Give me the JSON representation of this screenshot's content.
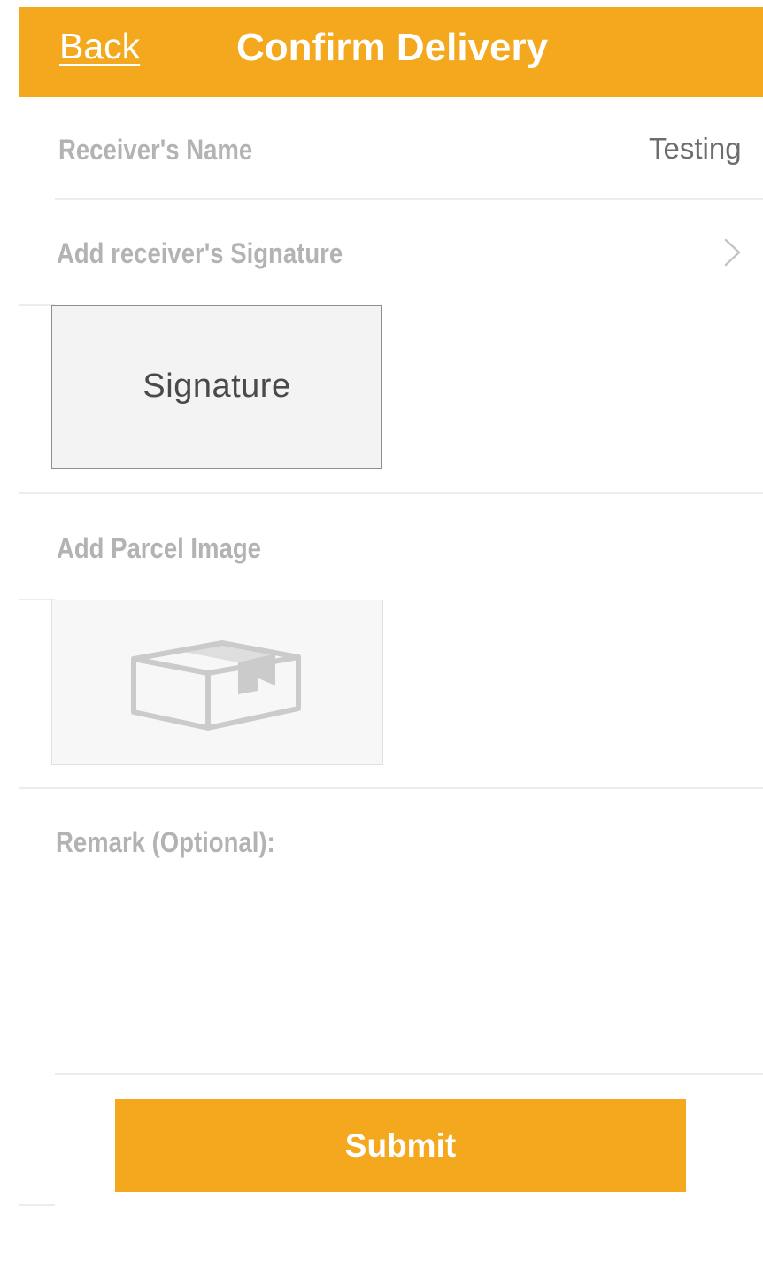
{
  "header": {
    "back_label": "Back",
    "title": "Confirm Delivery"
  },
  "receiver": {
    "label": "Receiver's Name",
    "value": "Testing"
  },
  "signature": {
    "label": "Add receiver's Signature",
    "box_label": "Signature",
    "chevron_icon": "chevron-right-icon"
  },
  "parcel": {
    "label": "Add Parcel Image",
    "icon": "parcel-box-icon"
  },
  "remark": {
    "label": "Remark (Optional):",
    "value": ""
  },
  "submit": {
    "label": "Submit"
  },
  "colors": {
    "accent": "#f4a81d",
    "label_gray": "#b3b3b3",
    "value_gray": "#6d6d6d",
    "divider": "#ececec"
  }
}
